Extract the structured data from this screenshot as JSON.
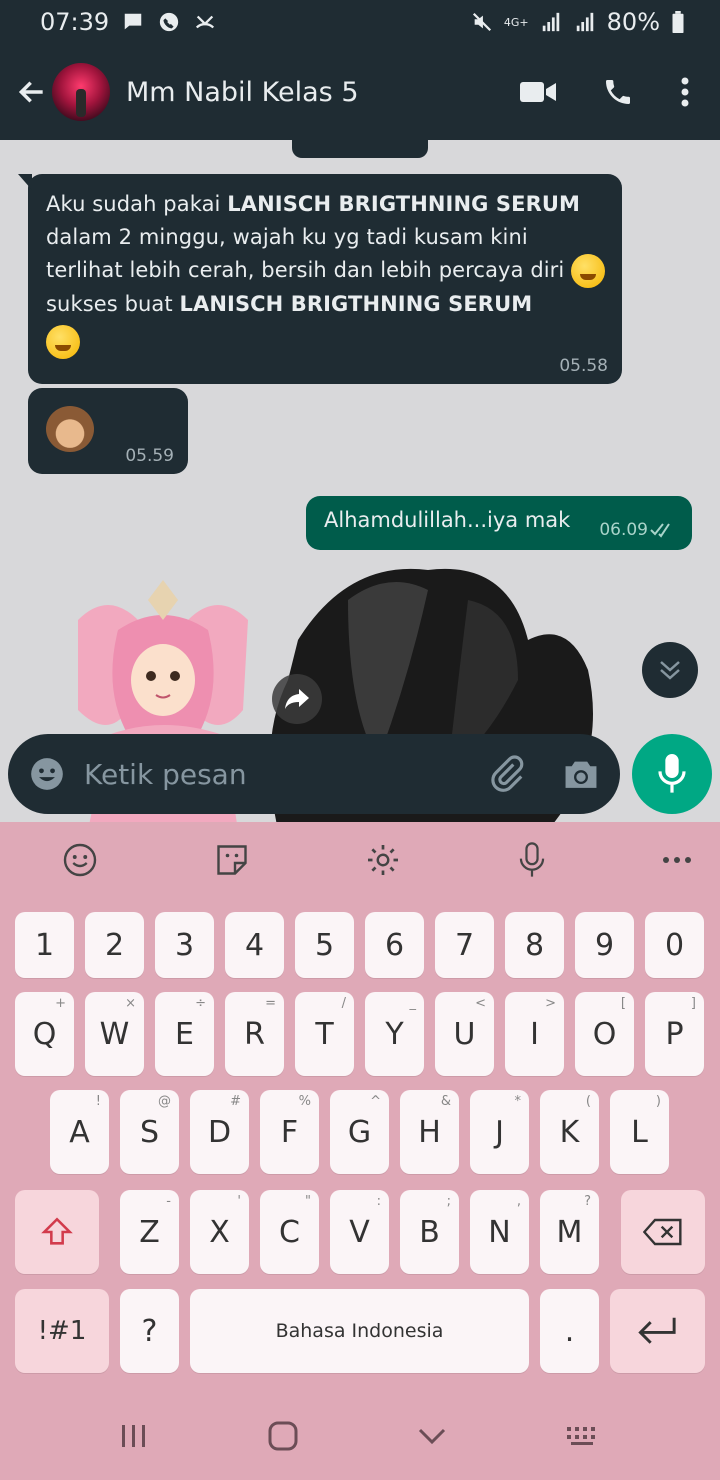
{
  "status": {
    "time": "07:39",
    "network": "4G+",
    "battery": "80%"
  },
  "header": {
    "contact_name": "Mm Nabil Kelas 5"
  },
  "messages": [
    {
      "direction": "incoming",
      "parts": [
        "Aku sudah pakai ",
        "LANISCH BRIGTHNING SERUM",
        " dalam 2 minggu, wajah ku yg tadi kusam kini terlihat lebih cerah, bersih dan lebih percaya diri ",
        " sukses buat ",
        "LANISCH BRIGTHNING SERUM"
      ],
      "time": "05.58"
    },
    {
      "direction": "incoming",
      "time": "05.59"
    },
    {
      "direction": "outgoing",
      "text": "Alhamdulillah...iya mak",
      "time": "06.09"
    }
  ],
  "input": {
    "placeholder": "Ketik pesan"
  },
  "keyboard": {
    "numbers": [
      "1",
      "2",
      "3",
      "4",
      "5",
      "6",
      "7",
      "8",
      "9",
      "0"
    ],
    "row1": [
      {
        "k": "Q",
        "s": "+"
      },
      {
        "k": "W",
        "s": "×"
      },
      {
        "k": "E",
        "s": "÷"
      },
      {
        "k": "R",
        "s": "="
      },
      {
        "k": "T",
        "s": "/"
      },
      {
        "k": "Y",
        "s": "_"
      },
      {
        "k": "U",
        "s": "<"
      },
      {
        "k": "I",
        "s": ">"
      },
      {
        "k": "O",
        "s": "["
      },
      {
        "k": "P",
        "s": "]"
      }
    ],
    "row2": [
      {
        "k": "A",
        "s": "!"
      },
      {
        "k": "S",
        "s": "@"
      },
      {
        "k": "D",
        "s": "#"
      },
      {
        "k": "F",
        "s": "%"
      },
      {
        "k": "G",
        "s": "^"
      },
      {
        "k": "H",
        "s": "&"
      },
      {
        "k": "J",
        "s": "*"
      },
      {
        "k": "K",
        "s": "("
      },
      {
        "k": "L",
        "s": ")"
      }
    ],
    "row3": [
      {
        "k": "Z",
        "s": "-"
      },
      {
        "k": "X",
        "s": "'"
      },
      {
        "k": "C",
        "s": "\""
      },
      {
        "k": "V",
        "s": ":"
      },
      {
        "k": "B",
        "s": ";"
      },
      {
        "k": "N",
        "s": ","
      },
      {
        "k": "M",
        "s": "?"
      }
    ],
    "symbols_label": "!#1",
    "question_label": "?",
    "space_label": "Bahasa Indonesia",
    "period_label": "."
  },
  "colors": {
    "header_bg": "#1f2c33",
    "outgoing_bubble": "#005c4b",
    "accent": "#00a884",
    "keyboard_bg": "#dfa9b7"
  }
}
